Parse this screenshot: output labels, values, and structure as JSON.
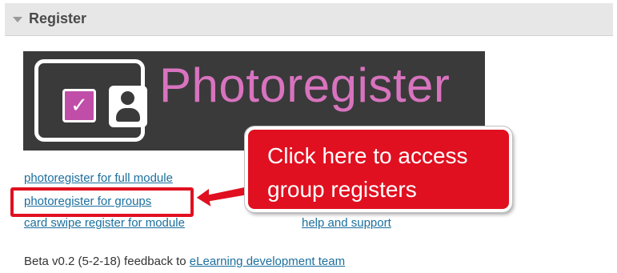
{
  "block": {
    "title": "Register",
    "icon": "collapse-arrow-icon"
  },
  "banner": {
    "text": "Photoregister",
    "check_glyph": "✓",
    "colors": {
      "background": "#3a3a3a",
      "accent": "#d873bf",
      "checkbox": "#c04ea8"
    }
  },
  "links": {
    "full_module": "photoregister for full module",
    "groups": "photoregister for groups",
    "card_swipe": "card swipe register for module",
    "help": "help and support"
  },
  "callout": {
    "text": "Click here to access group registers",
    "color": "#e01020"
  },
  "footer": {
    "prefix": "Beta v0.2 (5-2-18) feedback to ",
    "link": "eLearning development team"
  }
}
